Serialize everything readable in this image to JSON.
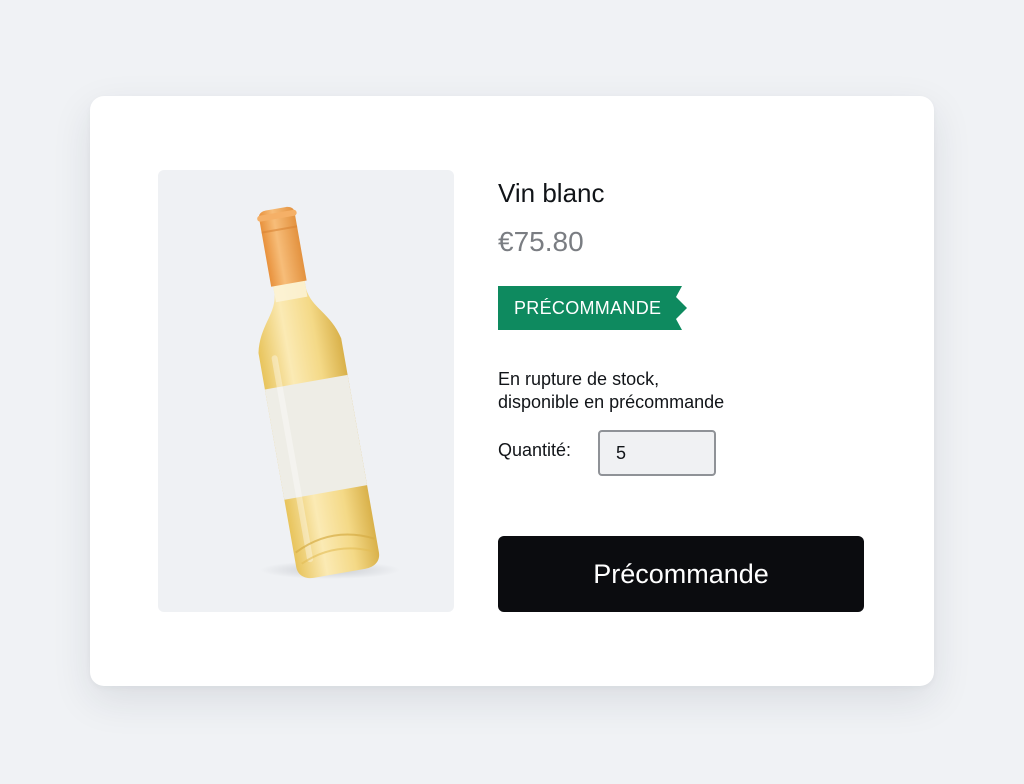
{
  "product": {
    "image_alt": "white-wine-bottle",
    "title": "Vin blanc",
    "price": "€75.80",
    "badge": {
      "label": "PRÉCOMMANDE",
      "color": "#0e8a5f"
    },
    "stock_line1": "En rupture de stock,",
    "stock_line2": "disponible en précommande",
    "quantity_label": "Quantité:",
    "quantity_value": "5",
    "cta_label": "Précommande"
  },
  "colors": {
    "background": "#f0f2f5",
    "card": "#ffffff",
    "image_panel": "#eff1f4",
    "price_text": "#7a7d82",
    "cta_background": "#0b0c0f",
    "bottle_cap": "#f2a757",
    "wine": "#f3dd96"
  }
}
